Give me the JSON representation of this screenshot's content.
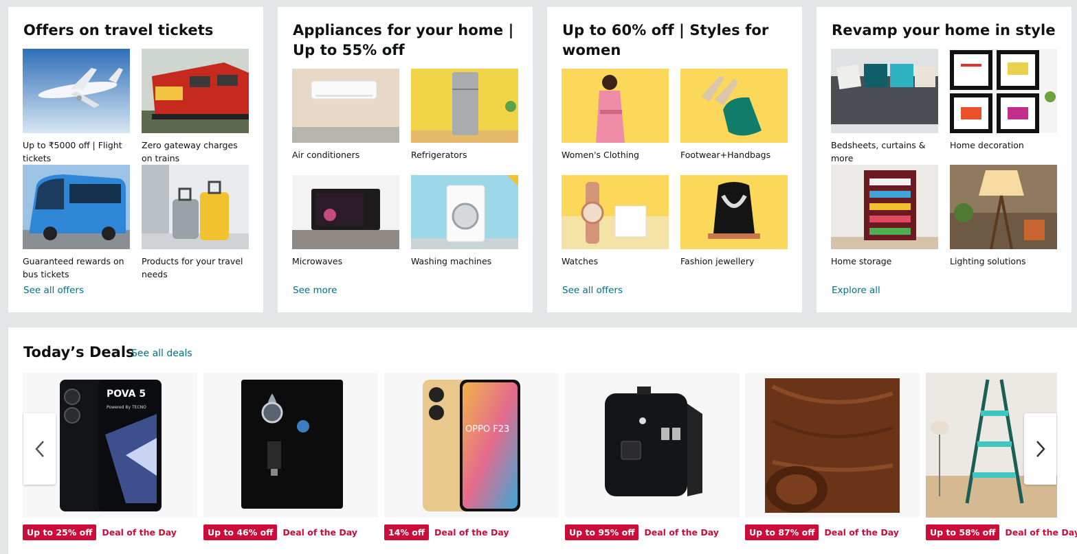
{
  "cards": [
    {
      "title": "Offers on travel tickets",
      "tiles": [
        {
          "caption": "Up to ₹5000 off | Flight tickets",
          "icon": "airplane-image"
        },
        {
          "caption": "Zero gateway charges on trains",
          "icon": "train-image"
        },
        {
          "caption": "Guaranteed rewards on bus tickets",
          "icon": "bus-image"
        },
        {
          "caption": "Products for your travel needs",
          "icon": "luggage-image"
        }
      ],
      "link": "See all offers"
    },
    {
      "title": "Appliances for your home | Up to 55% off",
      "tiles": [
        {
          "caption": "Air conditioners",
          "icon": "air-conditioner-image"
        },
        {
          "caption": "Refrigerators",
          "icon": "refrigerator-image"
        },
        {
          "caption": "Microwaves",
          "icon": "microwave-image"
        },
        {
          "caption": "Washing machines",
          "icon": "washing-machine-image"
        }
      ],
      "link": "See more"
    },
    {
      "title": "Up to 60% off | Styles for women",
      "tiles": [
        {
          "caption": "Women's Clothing",
          "icon": "womens-clothing-image"
        },
        {
          "caption": "Footwear+Handbags",
          "icon": "footwear-handbag-image"
        },
        {
          "caption": "Watches",
          "icon": "watch-image"
        },
        {
          "caption": "Fashion jewellery",
          "icon": "jewellery-image"
        }
      ],
      "link": "See all offers"
    },
    {
      "title": "Revamp your home in style",
      "tiles": [
        {
          "caption": "Bedsheets, curtains & more",
          "icon": "sofa-cushions-image"
        },
        {
          "caption": "Home decoration",
          "icon": "wall-frames-image"
        },
        {
          "caption": "Home storage",
          "icon": "shoe-rack-image"
        },
        {
          "caption": "Lighting solutions",
          "icon": "floor-lamp-image"
        }
      ],
      "link": "Explore all"
    }
  ],
  "deals": {
    "title": "Today’s Deals",
    "see_all": "See all deals",
    "items": [
      {
        "discount": "Up to 25% off",
        "label": "Deal of the Day",
        "icon": "phone-image",
        "phone_text": "POVA 5",
        "phone_sub": "Powered By TECNO"
      },
      {
        "discount": "Up to 46% off",
        "label": "Deal of the Day",
        "icon": "water-purifier-image"
      },
      {
        "discount": "14% off",
        "label": "Deal of the Day",
        "icon": "oppo-phone-image",
        "phone_text": "OPPO F23"
      },
      {
        "discount": "Up to 95% off",
        "label": "Deal of the Day",
        "icon": "travel-adapter-image"
      },
      {
        "discount": "Up to 87% off",
        "label": "Deal of the Day",
        "icon": "wood-sticker-image"
      },
      {
        "discount": "Up to 58% off",
        "label": "Deal of the Day",
        "icon": "ladder-image"
      }
    ]
  },
  "colors": {
    "link": "#007185",
    "deal_red": "#cc0c39",
    "page_bg": "#e3e6e6"
  }
}
